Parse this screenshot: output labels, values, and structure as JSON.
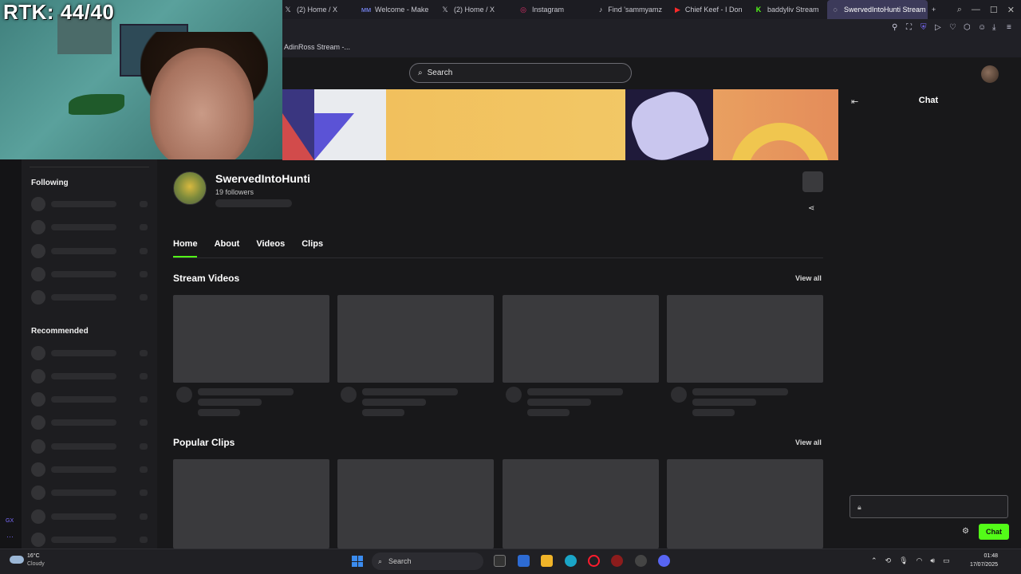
{
  "overlay": {
    "rtk_text": "RTK: 44/40"
  },
  "browser": {
    "tabs": [
      {
        "label": "(2) Home / X",
        "icon": "x-icon"
      },
      {
        "label": "Welcome - Make",
        "icon": "mm-icon"
      },
      {
        "label": "(2) Home / X",
        "icon": "x-icon"
      },
      {
        "label": "Instagram",
        "icon": "instagram-icon"
      },
      {
        "label": "Find 'sammyamz",
        "icon": "tiktok-icon"
      },
      {
        "label": "Chief Keef - I Don",
        "icon": "youtube-icon"
      },
      {
        "label": "baddyliv Stream",
        "icon": "kick-icon"
      },
      {
        "label": "SwervedIntoHunti Stream",
        "icon": "loading-icon"
      }
    ],
    "new_tab": "+",
    "bookmark": "AdinRoss Stream -..."
  },
  "header": {
    "search_placeholder": "Search"
  },
  "sidebar": {
    "following_label": "Following",
    "recommended_label": "Recommended"
  },
  "channel": {
    "name": "SwervedIntoHunti",
    "followers": "19 followers",
    "tabs": [
      "Home",
      "About",
      "Videos",
      "Clips"
    ]
  },
  "sections": {
    "stream_videos": "Stream Videos",
    "popular_clips": "Popular Clips",
    "view_all": "View all"
  },
  "chat": {
    "title": "Chat",
    "send_label": "Chat"
  },
  "taskbar": {
    "weather_temp": "16°C",
    "weather_desc": "Cloudy",
    "search_label": "Search",
    "time": "01:48",
    "date": "17/07/2025"
  },
  "colors": {
    "accent": "#53fc18",
    "bg": "#18181a"
  }
}
